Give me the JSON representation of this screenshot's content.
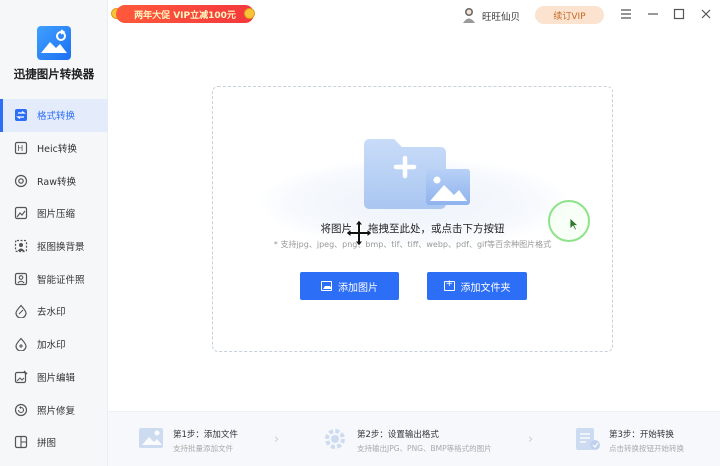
{
  "app": {
    "name": "迅捷图片转换器",
    "brand_color": "#2d6ef6"
  },
  "sidebar": {
    "items": [
      {
        "label": "格式转换",
        "icon": "format-convert-icon",
        "active": true
      },
      {
        "label": "Heic转换",
        "icon": "heic-icon",
        "active": false
      },
      {
        "label": "Raw转换",
        "icon": "camera-raw-icon",
        "active": false
      },
      {
        "label": "图片压缩",
        "icon": "compress-icon",
        "active": false
      },
      {
        "label": "抠图换背景",
        "icon": "cutout-icon",
        "active": false
      },
      {
        "label": "智能证件照",
        "icon": "id-photo-icon",
        "active": false
      },
      {
        "label": "去水印",
        "icon": "remove-watermark-icon",
        "active": false
      },
      {
        "label": "加水印",
        "icon": "add-watermark-icon",
        "active": false
      },
      {
        "label": "图片编辑",
        "icon": "edit-image-icon",
        "active": false
      },
      {
        "label": "照片修复",
        "icon": "restore-photo-icon",
        "active": false
      },
      {
        "label": "拼图",
        "icon": "collage-icon",
        "active": false
      }
    ]
  },
  "topbar": {
    "promo": "两年大促 VIP立减100元",
    "username": "旺旺仙贝",
    "vip_button": "续订VIP",
    "window_controls": [
      "menu-icon",
      "minimize-icon",
      "maximize-icon",
      "close-icon"
    ]
  },
  "dropzone": {
    "hint_part1": "将图片",
    "hint_part2": "拖拽至此处，或点击下方按钮",
    "formats": "* 支持jpg、jpeg、png、bmp、tif、tiff、webp、pdf、gif等百余种图片格式",
    "add_image_button": "添加图片",
    "add_folder_button": "添加文件夹"
  },
  "steps": [
    {
      "title": "第1步：添加文件",
      "desc": "支持批量添加文件"
    },
    {
      "title": "第2步：设置输出格式",
      "desc": "支持输出JPG、PNG、BMP等格式的图片"
    },
    {
      "title": "第3步：开始转换",
      "desc": "点击转换按钮开始转换"
    }
  ]
}
